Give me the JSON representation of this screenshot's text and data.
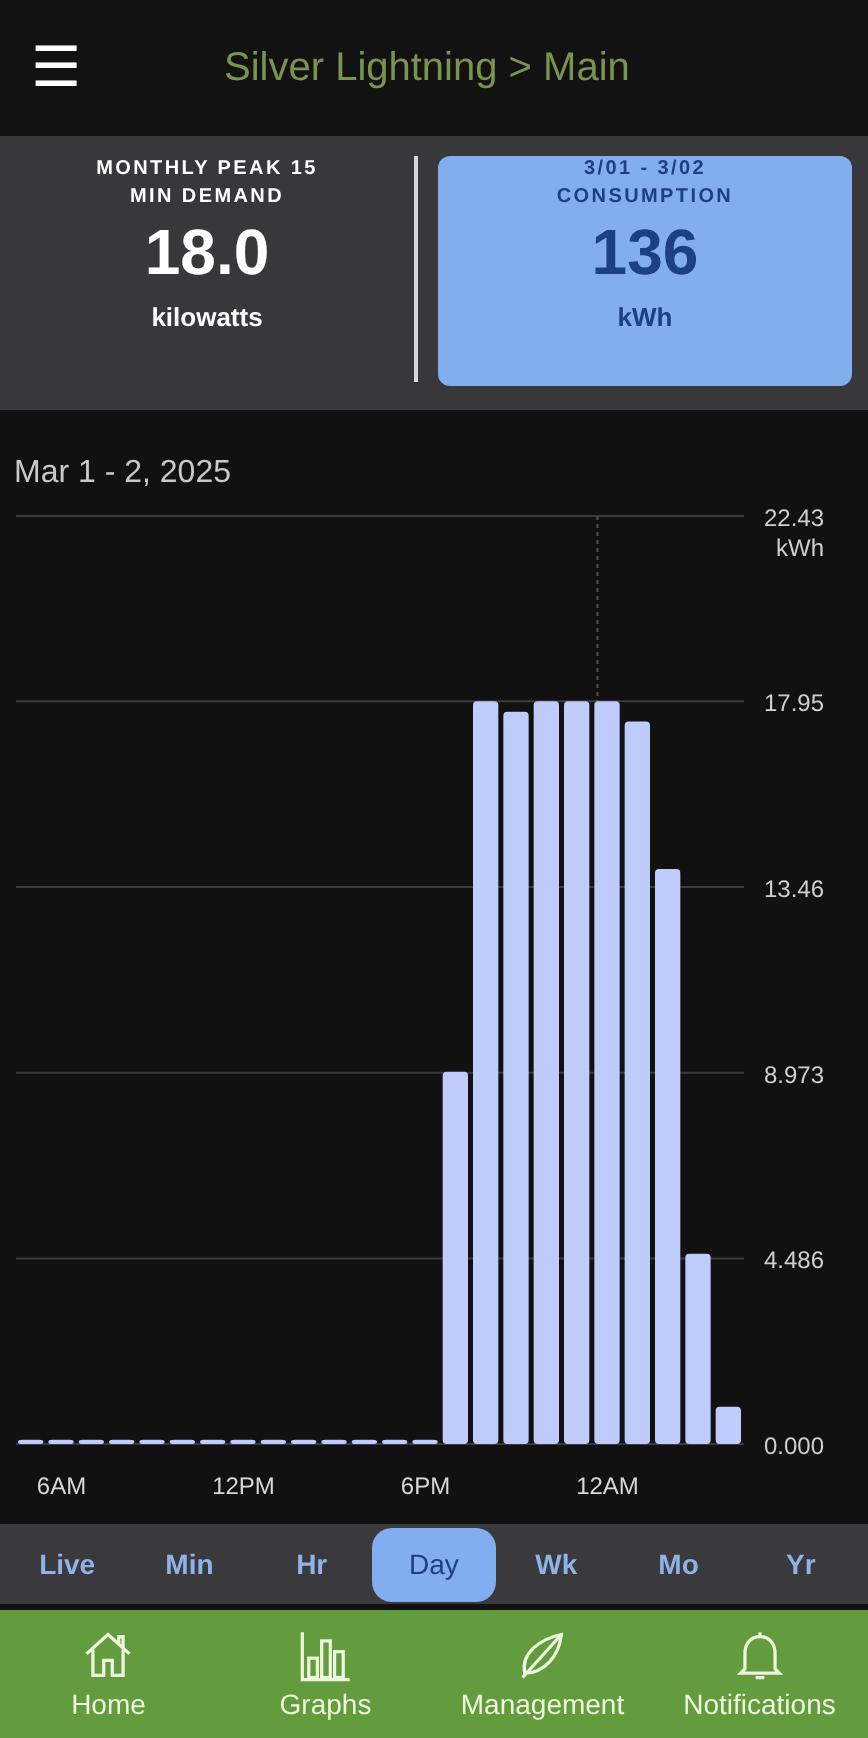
{
  "header": {
    "menu_icon": "☰",
    "title": "Silver Lightning > Main"
  },
  "cards": [
    {
      "caption": "MONTHLY PEAK 15 MIN DEMAND",
      "value": "18.0",
      "unit": "kilowatts",
      "selected": false
    },
    {
      "caption": "3/01 - 3/02 CONSUMPTION",
      "value": "136",
      "unit": "kWh",
      "selected": true
    }
  ],
  "date_range": "Mar 1 - 2, 2025",
  "chart_data": {
    "type": "bar",
    "grid": true,
    "ylabel": "kWh",
    "categories": [
      null,
      "6AM",
      null,
      null,
      null,
      null,
      null,
      "12PM",
      null,
      null,
      null,
      null,
      null,
      "6PM",
      null,
      null,
      null,
      null,
      null,
      "12AM",
      null,
      null,
      null,
      null
    ],
    "values": [
      0.1,
      0.1,
      0.1,
      0.1,
      0.1,
      0.1,
      0.1,
      0.1,
      0.1,
      0.1,
      0.1,
      0.1,
      0.1,
      0.1,
      9.0,
      17.95,
      17.7,
      17.95,
      17.95,
      17.95,
      17.46,
      13.9,
      4.6,
      0.9
    ],
    "ylim": [
      0,
      22.43
    ],
    "yticks": [
      {
        "value": 0,
        "label": "0.000"
      },
      {
        "value": 4.486,
        "label": "4.486"
      },
      {
        "value": 8.973,
        "label": "8.973"
      },
      {
        "value": 13.46,
        "label": "13.46"
      },
      {
        "value": 17.95,
        "label": "17.95"
      },
      {
        "value": 22.43,
        "label": "22.43"
      }
    ]
  },
  "ranges": [
    {
      "label": "Live",
      "selected": false
    },
    {
      "label": "Min",
      "selected": false
    },
    {
      "label": "Hr",
      "selected": false
    },
    {
      "label": "Day",
      "selected": true
    },
    {
      "label": "Wk",
      "selected": false
    },
    {
      "label": "Mo",
      "selected": false
    },
    {
      "label": "Yr",
      "selected": false
    }
  ],
  "nav": [
    {
      "kind": "home",
      "label": "Home"
    },
    {
      "kind": "graphs",
      "label": "Graphs"
    },
    {
      "kind": "management",
      "label": "Management"
    },
    {
      "kind": "notifications",
      "label": "Notifications"
    }
  ]
}
